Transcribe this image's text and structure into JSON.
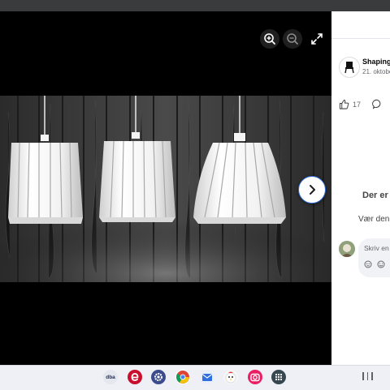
{
  "viewer": {
    "controls": [
      {
        "name": "zoom-in-icon"
      },
      {
        "name": "zoom-out-icon"
      },
      {
        "name": "fullscreen-icon"
      }
    ],
    "next_icon": "chevron-right-icon",
    "photo_subject": "three white pendant lamps"
  },
  "post": {
    "title": "Shaping",
    "date": "21. oktobe",
    "likes": "17"
  },
  "comments": {
    "empty_title": "Der er",
    "empty_sub": "Vær den",
    "input_placeholder": "Skriv en"
  },
  "taskbar": {
    "apps": [
      {
        "name": "dba-app",
        "label": "dba"
      },
      {
        "name": "e-app"
      },
      {
        "name": "settings-app"
      },
      {
        "name": "chrome-app"
      },
      {
        "name": "mail-app"
      },
      {
        "name": "game-app"
      },
      {
        "name": "camera-app"
      },
      {
        "name": "app-drawer"
      }
    ]
  },
  "colors": {
    "accent": "#2d6cdf",
    "panel_bg": "#ffffff",
    "viewer_bg": "#000000"
  }
}
